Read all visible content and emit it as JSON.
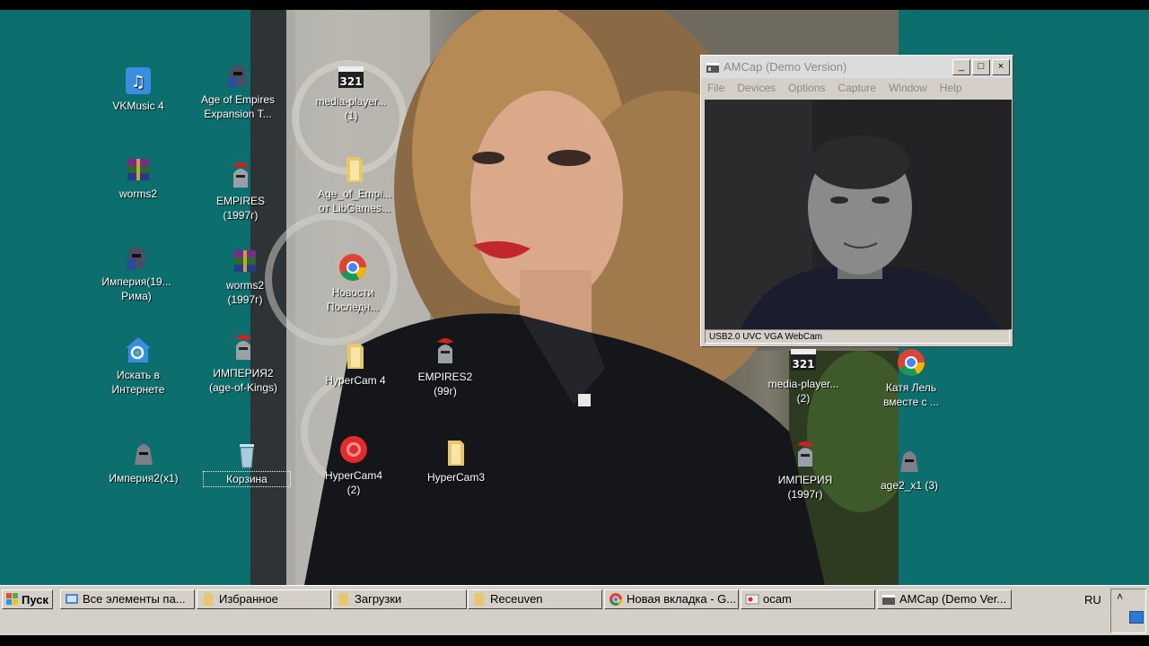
{
  "desktop": {
    "icons": [
      {
        "label": "VKMusic 4",
        "icon": "vkmusic-icon"
      },
      {
        "label": "Age of Empires\nExpansion T...",
        "icon": "aoe-helmet-icon"
      },
      {
        "label": "media-player...\n(1)",
        "icon": "mpc-321-icon"
      },
      {
        "label": "worms2",
        "icon": "winrar-archive-icon"
      },
      {
        "label": "EMPIRES\n(1997г)",
        "icon": "empires-helmet-icon"
      },
      {
        "label": "Age_of_Empi...\nот LibGames...",
        "icon": "folder-icon"
      },
      {
        "label": "Империя(19...\nРима)",
        "icon": "aoe-helmet-icon"
      },
      {
        "label": "worms2\n(1997г)",
        "icon": "winrar-archive-icon"
      },
      {
        "label": "Новости\nПоследн...",
        "icon": "chrome-icon"
      },
      {
        "label": "Искать в\nИнтернете",
        "icon": "ie-search-icon"
      },
      {
        "label": "ИМПЕРИЯ2\n(age-of-Kings)",
        "icon": "empires-helmet-icon"
      },
      {
        "label": "HyperCam 4",
        "icon": "folder-icon"
      },
      {
        "label": "EMPIRES2\n(99г)",
        "icon": "empires-helmet-icon"
      },
      {
        "label": "Империя2(x1)",
        "icon": "aoe2-helmet-icon"
      },
      {
        "label": "Корзина",
        "icon": "recycle-bin-icon"
      },
      {
        "label": "HyperCam4\n(2)",
        "icon": "hypercam-record-icon"
      },
      {
        "label": "HyperCam3",
        "icon": "folder-icon"
      },
      {
        "label": "media-player...\n(2)",
        "icon": "mpc-321-icon"
      },
      {
        "label": "Катя  Лель\nвместе  с ...",
        "icon": "chrome-icon"
      },
      {
        "label": "ИМПЕРИЯ\n(1997г)",
        "icon": "empires-helmet-icon"
      },
      {
        "label": "age2_x1  (3)",
        "icon": "aoe2-helmet-icon"
      }
    ]
  },
  "amcap": {
    "title": "AMCap (Demo Version)",
    "menu": [
      "File",
      "Devices",
      "Options",
      "Capture",
      "Window",
      "Help"
    ],
    "status": "USB2.0 UVC VGA WebCam",
    "controls": {
      "minimize": "_",
      "maximize": "□",
      "close": "×"
    }
  },
  "taskbar": {
    "start_label": "Пуск",
    "tasks": [
      {
        "label": "Все элементы па...",
        "icon": "control-panel-icon"
      },
      {
        "label": "Избранное",
        "icon": "folder-icon"
      },
      {
        "label": "Загрузки",
        "icon": "folder-icon"
      },
      {
        "label": "Receuven",
        "icon": "folder-icon"
      },
      {
        "label": "Новая вкладка - G...",
        "icon": "chrome-icon"
      },
      {
        "label": "ocam",
        "icon": "ocam-icon"
      },
      {
        "label": "AMCap (Demo Ver...",
        "icon": "amcap-icon"
      }
    ],
    "language": "RU",
    "tray_expand": "˄"
  },
  "colors": {
    "desktop_bg": "#0d6e6e",
    "taskbar_bg": "#d4d0c8"
  }
}
